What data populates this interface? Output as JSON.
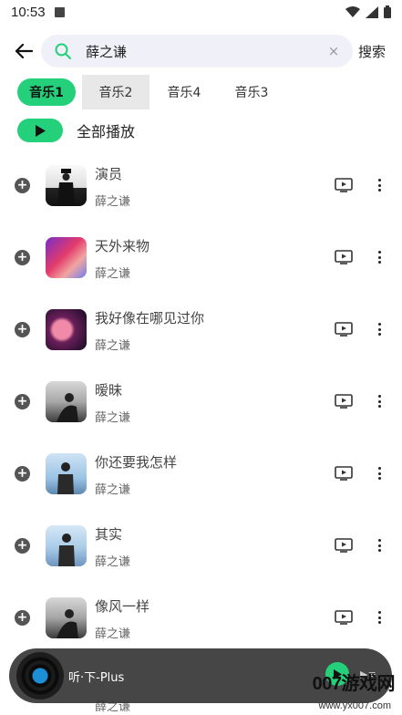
{
  "status": {
    "time": "10:53"
  },
  "search": {
    "query": "薛之谦",
    "button_label": "搜索",
    "clear_glyph": "×"
  },
  "tabs": [
    {
      "label": "音乐1",
      "active": true
    },
    {
      "label": "音乐2",
      "active": false
    },
    {
      "label": "音乐4",
      "active": false
    },
    {
      "label": "音乐3",
      "active": false
    }
  ],
  "play_all": {
    "label": "全部播放"
  },
  "songs": [
    {
      "title": "演员",
      "artist": "薛之谦"
    },
    {
      "title": "天外来物",
      "artist": "薛之谦"
    },
    {
      "title": "我好像在哪见过你",
      "artist": "薛之谦"
    },
    {
      "title": "暧昧",
      "artist": "薛之谦"
    },
    {
      "title": "你还要我怎样",
      "artist": "薛之谦"
    },
    {
      "title": "其实",
      "artist": "薛之谦"
    },
    {
      "title": "像风一样",
      "artist": "薛之谦"
    }
  ],
  "peek": {
    "artist": "薛之谦"
  },
  "player": {
    "title": "听·下-Plus"
  },
  "watermark": {
    "brand": "007游戏网",
    "url": "www.yx007.com"
  },
  "colors": {
    "accent": "#25d07a",
    "search_bg": "#f0f1f8",
    "player_bg": "#323232"
  },
  "icons": {
    "back": "arrow-left-icon",
    "search": "search-icon",
    "clear": "close-icon",
    "add": "plus-circle-icon",
    "mv": "video-icon",
    "more": "more-vertical-icon",
    "play": "play-icon"
  }
}
